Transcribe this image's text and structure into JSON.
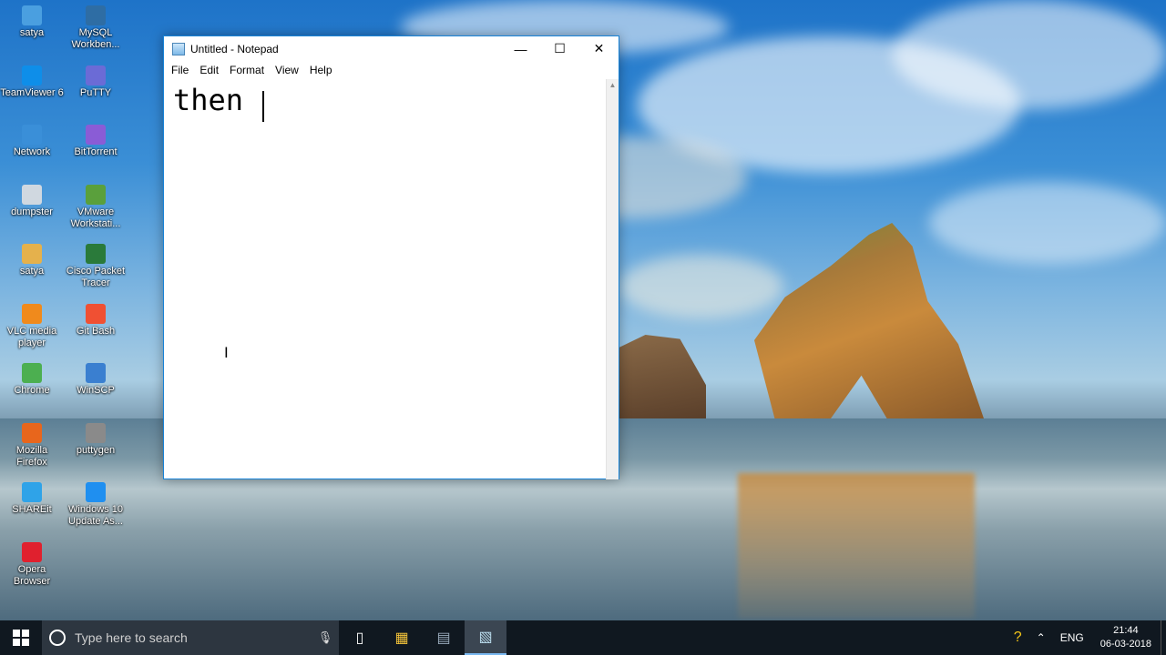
{
  "desktop_icons": [
    {
      "label": "satya",
      "icon": "folder-icon",
      "color": "#4a9fe0"
    },
    {
      "label": "MySQL Workben...",
      "icon": "mysql-icon",
      "color": "#2e6da4"
    },
    {
      "label": "TeamViewer 6",
      "icon": "teamviewer-icon",
      "color": "#0e8ee9"
    },
    {
      "label": "PuTTY",
      "icon": "putty-icon",
      "color": "#6b6bd6"
    },
    {
      "label": "Network",
      "icon": "network-icon",
      "color": "#3a8fd8"
    },
    {
      "label": "BitTorrent",
      "icon": "bittorrent-icon",
      "color": "#8a5cd6"
    },
    {
      "label": "dumpster",
      "icon": "recycle-bin-icon",
      "color": "#d0d8e0"
    },
    {
      "label": "VMware Workstati...",
      "icon": "vmware-icon",
      "color": "#5aa03c"
    },
    {
      "label": "satya",
      "icon": "user-icon",
      "color": "#e5b14c"
    },
    {
      "label": "Cisco Packet Tracer",
      "icon": "cisco-icon",
      "color": "#2a7a3a"
    },
    {
      "label": "VLC media player",
      "icon": "vlc-icon",
      "color": "#f08a1c"
    },
    {
      "label": "Git Bash",
      "icon": "git-icon",
      "color": "#f05033"
    },
    {
      "label": "Chrome",
      "icon": "chrome-icon",
      "color": "#4caf50"
    },
    {
      "label": "WinSCP",
      "icon": "winscp-icon",
      "color": "#3a7fd0"
    },
    {
      "label": "Mozilla Firefox",
      "icon": "firefox-icon",
      "color": "#e8661c"
    },
    {
      "label": "puttygen",
      "icon": "puttygen-icon",
      "color": "#8a8a8a"
    },
    {
      "label": "SHAREit",
      "icon": "shareit-icon",
      "color": "#2fa3e8"
    },
    {
      "label": "Windows 10 Update As...",
      "icon": "windows-update-icon",
      "color": "#1f8ff0"
    },
    {
      "label": "Opera Browser",
      "icon": "opera-icon",
      "color": "#e0202e"
    }
  ],
  "notepad": {
    "title": "Untitled - Notepad",
    "menu": [
      "File",
      "Edit",
      "Format",
      "View",
      "Help"
    ],
    "content": "then "
  },
  "taskbar": {
    "search_placeholder": "Type here to search",
    "language": "ENG",
    "time": "21:44",
    "date": "06-03-2018"
  }
}
